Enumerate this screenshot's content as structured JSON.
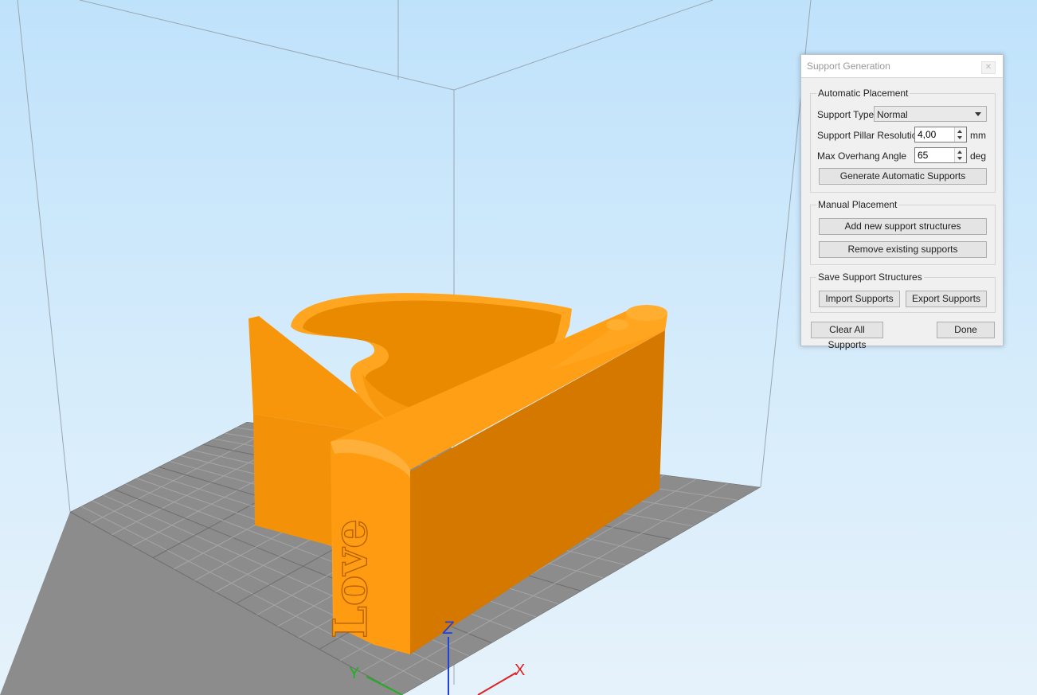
{
  "scene": {
    "model_engraving": "Love",
    "axis_labels": {
      "z": "Z",
      "x": "X",
      "y": "Y"
    },
    "colors": {
      "model_light": "#ffa31a",
      "model_mid": "#f5940a",
      "model_dark": "#d97a00",
      "bed": "#8c8c8c",
      "bed_grid": "#a9a9a9",
      "axis_x": "#e02020",
      "axis_y": "#20b020",
      "axis_z": "#2040e0"
    }
  },
  "panel": {
    "title": "Support Generation",
    "close_icon": "close-icon",
    "automatic": {
      "legend": "Automatic Placement",
      "support_type_label": "Support Type",
      "support_type_value": "Normal",
      "pillar_resolution_label": "Support Pillar Resolution",
      "pillar_resolution_value": "4,00",
      "pillar_resolution_unit": "mm",
      "overhang_label": "Max Overhang Angle",
      "overhang_value": "65",
      "overhang_unit": "deg",
      "generate_button": "Generate Automatic Supports"
    },
    "manual": {
      "legend": "Manual Placement",
      "add_button": "Add new support structures",
      "remove_button": "Remove existing supports"
    },
    "save": {
      "legend": "Save Support Structures",
      "import_button": "Import Supports",
      "export_button": "Export Supports"
    },
    "clear_button": "Clear All Supports",
    "done_button": "Done"
  }
}
